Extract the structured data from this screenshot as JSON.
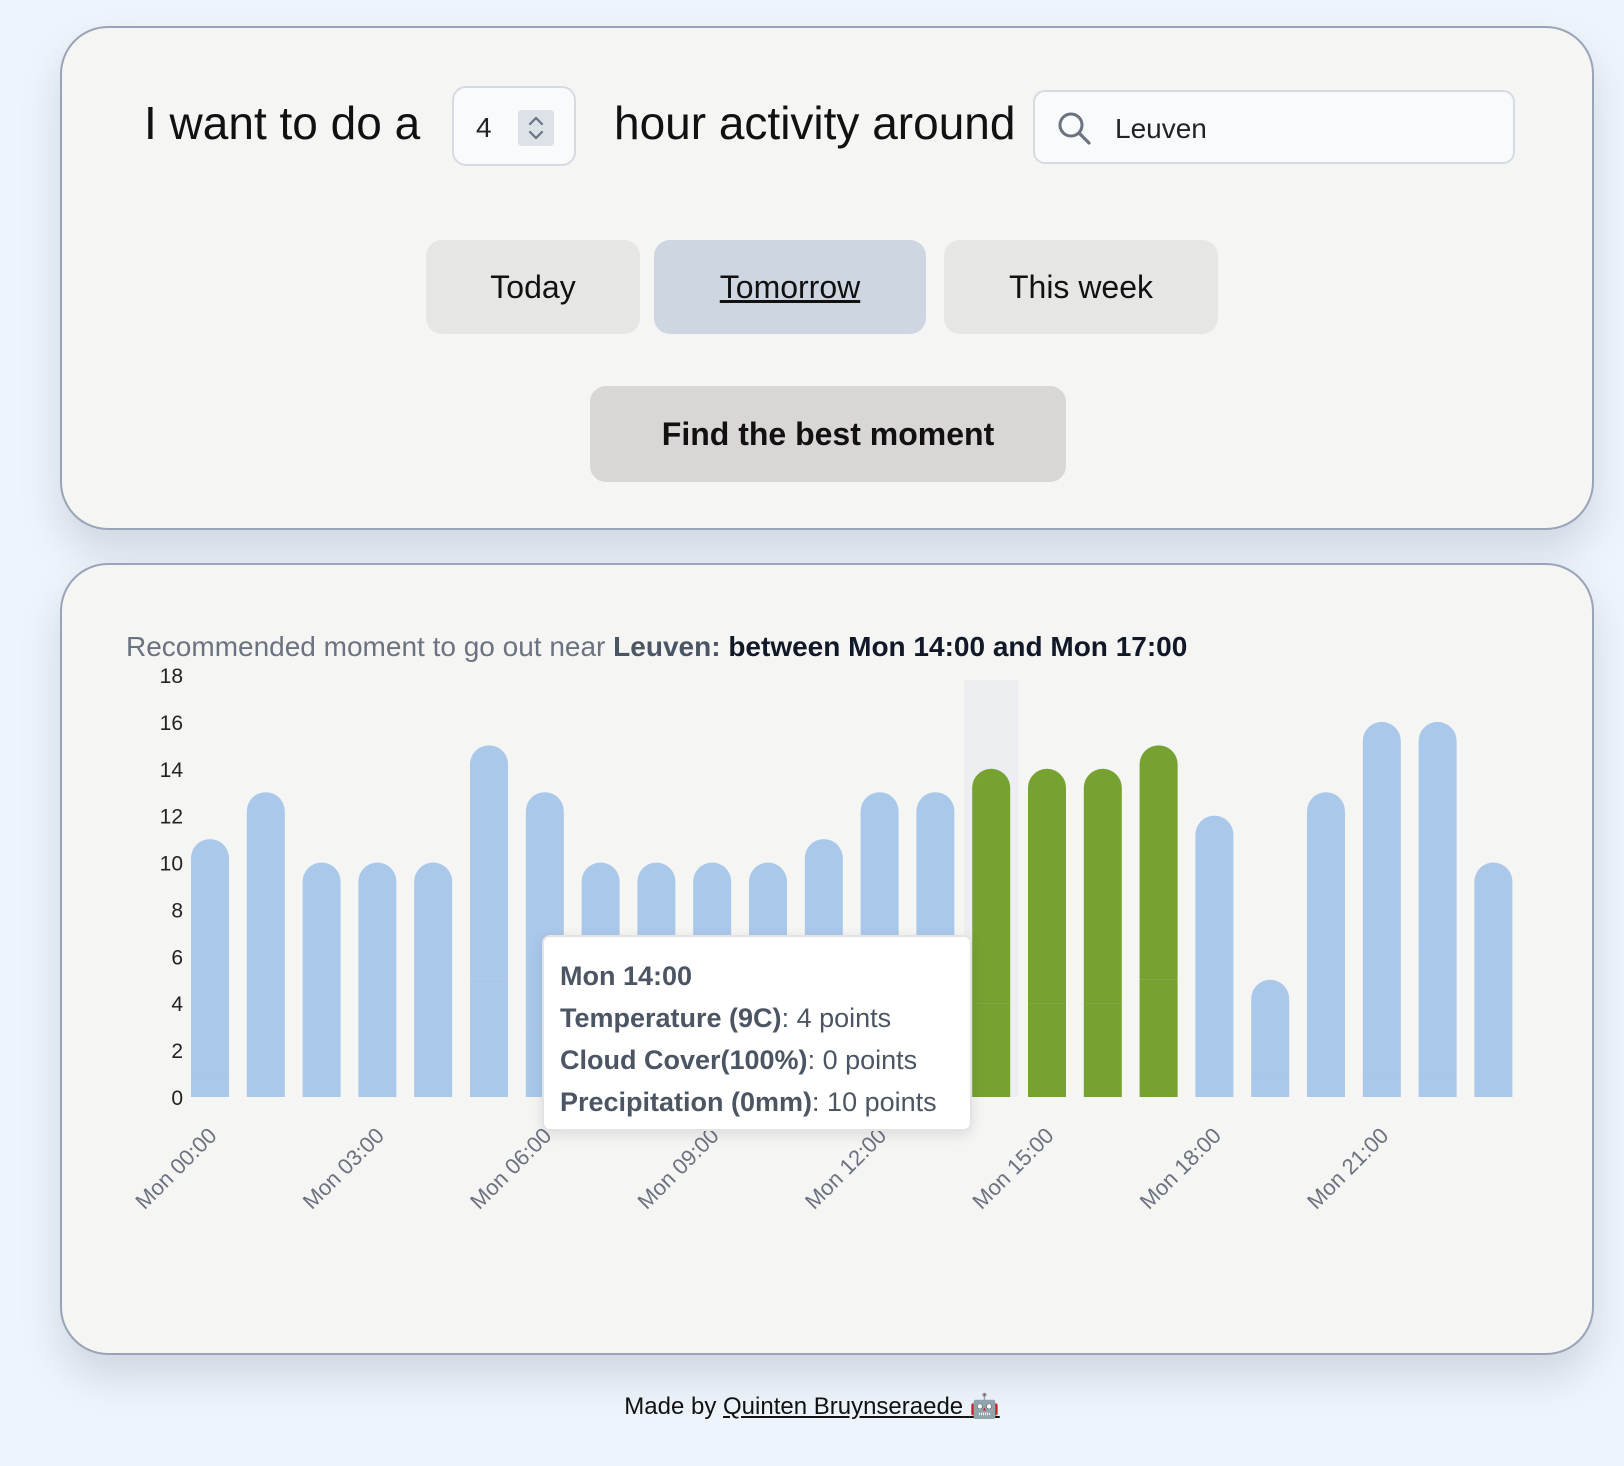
{
  "form": {
    "lead_text": "I want to do a",
    "hours_value": "4",
    "after_text": "hour activity around",
    "location_value": "Leuven",
    "day_options": [
      "Today",
      "Tomorrow",
      "This week"
    ],
    "selected_day": "Tomorrow",
    "find_button": "Find the best moment"
  },
  "result": {
    "prefix": "Recommended moment to go out near",
    "location": "Leuven:",
    "window": "between Mon 14:00 and Mon 17:00"
  },
  "tooltip": {
    "title": "Mon 14:00",
    "rows": [
      {
        "label": "Temperature (9C)",
        "value": ": 4 points"
      },
      {
        "label": "Cloud Cover(100%)",
        "value": ": 0 points"
      },
      {
        "label": "Precipitation (0mm)",
        "value": ": 10 points"
      }
    ]
  },
  "footer": {
    "text": "Made by",
    "author": "Quinten Bruynseraede",
    "emoji": "🤖"
  },
  "colors": {
    "bar_default": "#aac8ea",
    "bar_recommended": "#76a232",
    "hover_band": "#eceef1",
    "selected_button": "#cdd6e1"
  },
  "chart_data": {
    "type": "bar",
    "stacked": true,
    "categories": [
      "Mon 00:00",
      "Mon 01:00",
      "Mon 02:00",
      "Mon 03:00",
      "Mon 04:00",
      "Mon 05:00",
      "Mon 06:00",
      "Mon 07:00",
      "Mon 08:00",
      "Mon 09:00",
      "Mon 10:00",
      "Mon 11:00",
      "Mon 12:00",
      "Mon 13:00",
      "Mon 14:00",
      "Mon 15:00",
      "Mon 16:00",
      "Mon 17:00",
      "Mon 18:00",
      "Mon 19:00",
      "Mon 20:00",
      "Mon 21:00",
      "Mon 22:00",
      "Mon 23:00"
    ],
    "tick_labels": [
      "Mon 00:00",
      "Mon 03:00",
      "Mon 06:00",
      "Mon 09:00",
      "Mon 12:00",
      "Mon 15:00",
      "Mon 18:00",
      "Mon 21:00"
    ],
    "series": [
      {
        "values": [
          1,
          3,
          0,
          0,
          0,
          5,
          3,
          0,
          0,
          0,
          0,
          0,
          0,
          0,
          4,
          4,
          4,
          5,
          0,
          1,
          3,
          1,
          1,
          0
        ]
      },
      {
        "values": [
          0,
          0,
          0,
          0,
          0,
          0,
          0,
          0,
          0,
          0,
          0,
          0,
          0,
          0,
          0,
          0,
          0,
          0,
          0,
          0,
          0,
          5,
          5,
          0
        ]
      },
      {
        "values": [
          10,
          10,
          10,
          10,
          10,
          10,
          10,
          10,
          10,
          10,
          10,
          11,
          13,
          13,
          10,
          10,
          10,
          10,
          12,
          4,
          10,
          10,
          10,
          10
        ]
      }
    ],
    "totals": [
      11,
      13,
      10,
      10,
      10,
      15,
      13,
      10,
      10,
      10,
      10,
      11,
      13,
      13,
      14,
      14,
      14,
      15,
      12,
      5,
      13,
      16,
      16,
      10
    ],
    "highlighted": [
      "Mon 14:00",
      "Mon 15:00",
      "Mon 16:00",
      "Mon 17:00"
    ],
    "hovered": "Mon 14:00",
    "yticks": [
      0,
      2,
      4,
      6,
      8,
      10,
      12,
      14,
      16,
      18
    ],
    "ylim": [
      0,
      18
    ],
    "grid": false,
    "legend": "none"
  }
}
